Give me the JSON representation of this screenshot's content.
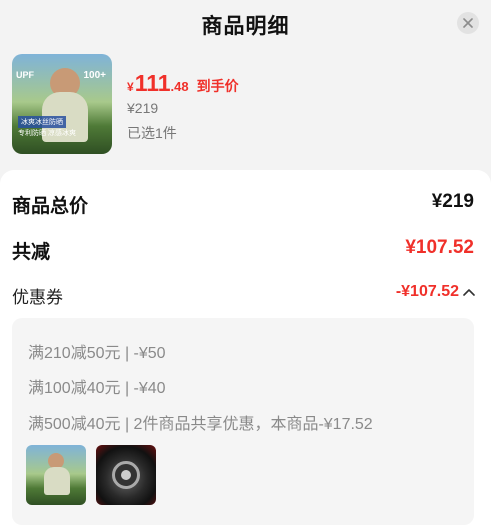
{
  "header": {
    "title": "商品明细",
    "close_icon": "close-icon"
  },
  "product": {
    "thumb_text_upf": "UPF",
    "thumb_text_badge": "100+",
    "thumb_caption_1": "冰爽冰丝防晒",
    "thumb_caption_2": "专利防晒 凉感冰爽",
    "price_currency": "¥",
    "price_integer": "111",
    "price_decimal": ".48",
    "price_label": "到手价",
    "original_price": "¥219",
    "selected_text": "已选1件"
  },
  "summary": {
    "total_label": "商品总价",
    "total_value": "¥219",
    "reduce_label": "共减",
    "reduce_value": "¥107.52",
    "coupon_label": "优惠券",
    "coupon_value": "-¥107.52",
    "coupon_expand_icon": "chevron-up-icon"
  },
  "coupon_details": [
    "满210减50元 | -¥50",
    "满100减40元 | -¥40",
    "满500减40元 | 2件商品共享优惠，本商品-¥17.52"
  ],
  "colors": {
    "accent_red": "#f0302a",
    "muted_text": "#8a8a8a"
  }
}
